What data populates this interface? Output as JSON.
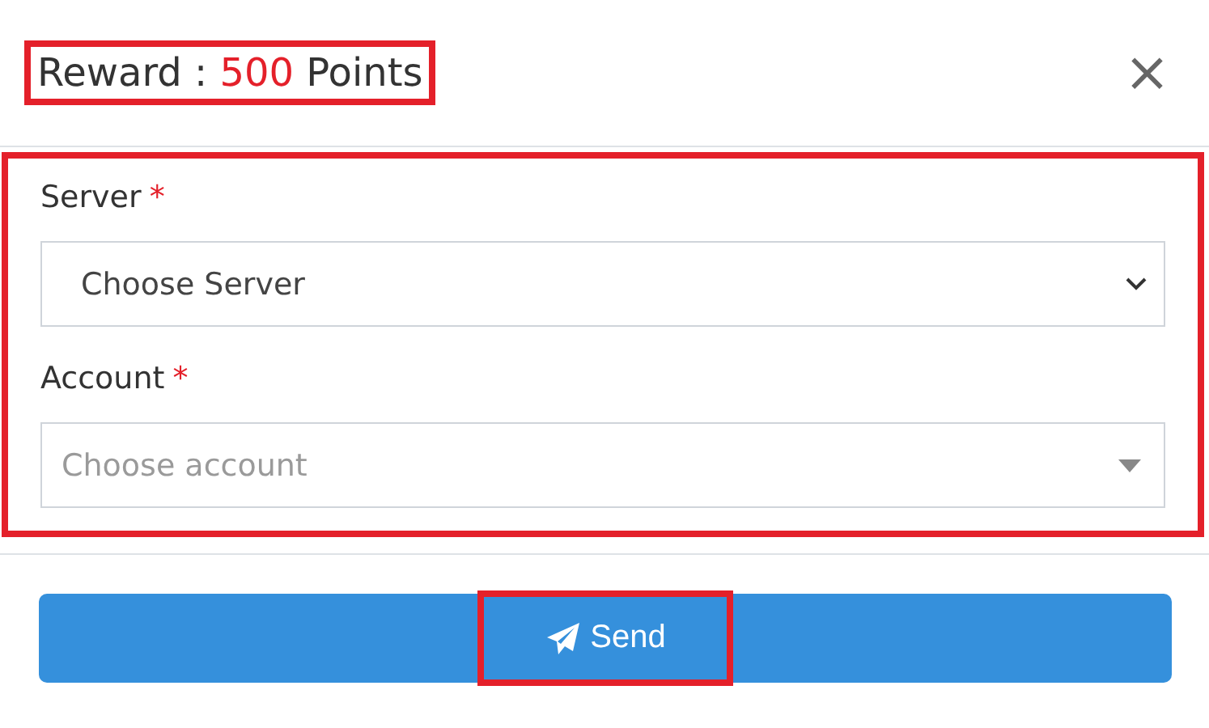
{
  "dialog": {
    "title": {
      "prefix": "Reward :",
      "points": "500",
      "suffix": "Points",
      "highlighted": true
    },
    "close": "×",
    "form": {
      "highlighted": true,
      "fields": [
        {
          "label": "Server",
          "required_mark": "*",
          "kind": "native",
          "value": "Choose Server"
        },
        {
          "label": "Account",
          "required_mark": "*",
          "kind": "select2",
          "placeholder": "Choose account"
        }
      ]
    },
    "send_button": {
      "label": "Send",
      "highlighted": true
    }
  }
}
